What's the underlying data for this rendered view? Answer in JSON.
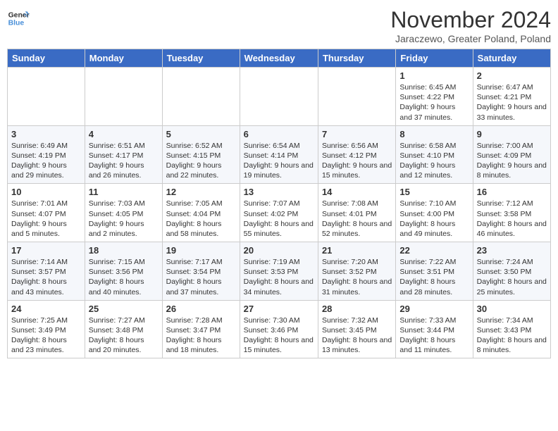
{
  "logo": {
    "line1": "General",
    "line2": "Blue"
  },
  "title": "November 2024",
  "location": "Jaraczewo, Greater Poland, Poland",
  "days_of_week": [
    "Sunday",
    "Monday",
    "Tuesday",
    "Wednesday",
    "Thursday",
    "Friday",
    "Saturday"
  ],
  "weeks": [
    [
      {
        "day": "",
        "detail": ""
      },
      {
        "day": "",
        "detail": ""
      },
      {
        "day": "",
        "detail": ""
      },
      {
        "day": "",
        "detail": ""
      },
      {
        "day": "",
        "detail": ""
      },
      {
        "day": "1",
        "detail": "Sunrise: 6:45 AM\nSunset: 4:22 PM\nDaylight: 9 hours and 37 minutes."
      },
      {
        "day": "2",
        "detail": "Sunrise: 6:47 AM\nSunset: 4:21 PM\nDaylight: 9 hours and 33 minutes."
      }
    ],
    [
      {
        "day": "3",
        "detail": "Sunrise: 6:49 AM\nSunset: 4:19 PM\nDaylight: 9 hours and 29 minutes."
      },
      {
        "day": "4",
        "detail": "Sunrise: 6:51 AM\nSunset: 4:17 PM\nDaylight: 9 hours and 26 minutes."
      },
      {
        "day": "5",
        "detail": "Sunrise: 6:52 AM\nSunset: 4:15 PM\nDaylight: 9 hours and 22 minutes."
      },
      {
        "day": "6",
        "detail": "Sunrise: 6:54 AM\nSunset: 4:14 PM\nDaylight: 9 hours and 19 minutes."
      },
      {
        "day": "7",
        "detail": "Sunrise: 6:56 AM\nSunset: 4:12 PM\nDaylight: 9 hours and 15 minutes."
      },
      {
        "day": "8",
        "detail": "Sunrise: 6:58 AM\nSunset: 4:10 PM\nDaylight: 9 hours and 12 minutes."
      },
      {
        "day": "9",
        "detail": "Sunrise: 7:00 AM\nSunset: 4:09 PM\nDaylight: 9 hours and 8 minutes."
      }
    ],
    [
      {
        "day": "10",
        "detail": "Sunrise: 7:01 AM\nSunset: 4:07 PM\nDaylight: 9 hours and 5 minutes."
      },
      {
        "day": "11",
        "detail": "Sunrise: 7:03 AM\nSunset: 4:05 PM\nDaylight: 9 hours and 2 minutes."
      },
      {
        "day": "12",
        "detail": "Sunrise: 7:05 AM\nSunset: 4:04 PM\nDaylight: 8 hours and 58 minutes."
      },
      {
        "day": "13",
        "detail": "Sunrise: 7:07 AM\nSunset: 4:02 PM\nDaylight: 8 hours and 55 minutes."
      },
      {
        "day": "14",
        "detail": "Sunrise: 7:08 AM\nSunset: 4:01 PM\nDaylight: 8 hours and 52 minutes."
      },
      {
        "day": "15",
        "detail": "Sunrise: 7:10 AM\nSunset: 4:00 PM\nDaylight: 8 hours and 49 minutes."
      },
      {
        "day": "16",
        "detail": "Sunrise: 7:12 AM\nSunset: 3:58 PM\nDaylight: 8 hours and 46 minutes."
      }
    ],
    [
      {
        "day": "17",
        "detail": "Sunrise: 7:14 AM\nSunset: 3:57 PM\nDaylight: 8 hours and 43 minutes."
      },
      {
        "day": "18",
        "detail": "Sunrise: 7:15 AM\nSunset: 3:56 PM\nDaylight: 8 hours and 40 minutes."
      },
      {
        "day": "19",
        "detail": "Sunrise: 7:17 AM\nSunset: 3:54 PM\nDaylight: 8 hours and 37 minutes."
      },
      {
        "day": "20",
        "detail": "Sunrise: 7:19 AM\nSunset: 3:53 PM\nDaylight: 8 hours and 34 minutes."
      },
      {
        "day": "21",
        "detail": "Sunrise: 7:20 AM\nSunset: 3:52 PM\nDaylight: 8 hours and 31 minutes."
      },
      {
        "day": "22",
        "detail": "Sunrise: 7:22 AM\nSunset: 3:51 PM\nDaylight: 8 hours and 28 minutes."
      },
      {
        "day": "23",
        "detail": "Sunrise: 7:24 AM\nSunset: 3:50 PM\nDaylight: 8 hours and 25 minutes."
      }
    ],
    [
      {
        "day": "24",
        "detail": "Sunrise: 7:25 AM\nSunset: 3:49 PM\nDaylight: 8 hours and 23 minutes."
      },
      {
        "day": "25",
        "detail": "Sunrise: 7:27 AM\nSunset: 3:48 PM\nDaylight: 8 hours and 20 minutes."
      },
      {
        "day": "26",
        "detail": "Sunrise: 7:28 AM\nSunset: 3:47 PM\nDaylight: 8 hours and 18 minutes."
      },
      {
        "day": "27",
        "detail": "Sunrise: 7:30 AM\nSunset: 3:46 PM\nDaylight: 8 hours and 15 minutes."
      },
      {
        "day": "28",
        "detail": "Sunrise: 7:32 AM\nSunset: 3:45 PM\nDaylight: 8 hours and 13 minutes."
      },
      {
        "day": "29",
        "detail": "Sunrise: 7:33 AM\nSunset: 3:44 PM\nDaylight: 8 hours and 11 minutes."
      },
      {
        "day": "30",
        "detail": "Sunrise: 7:34 AM\nSunset: 3:43 PM\nDaylight: 8 hours and 8 minutes."
      }
    ]
  ]
}
